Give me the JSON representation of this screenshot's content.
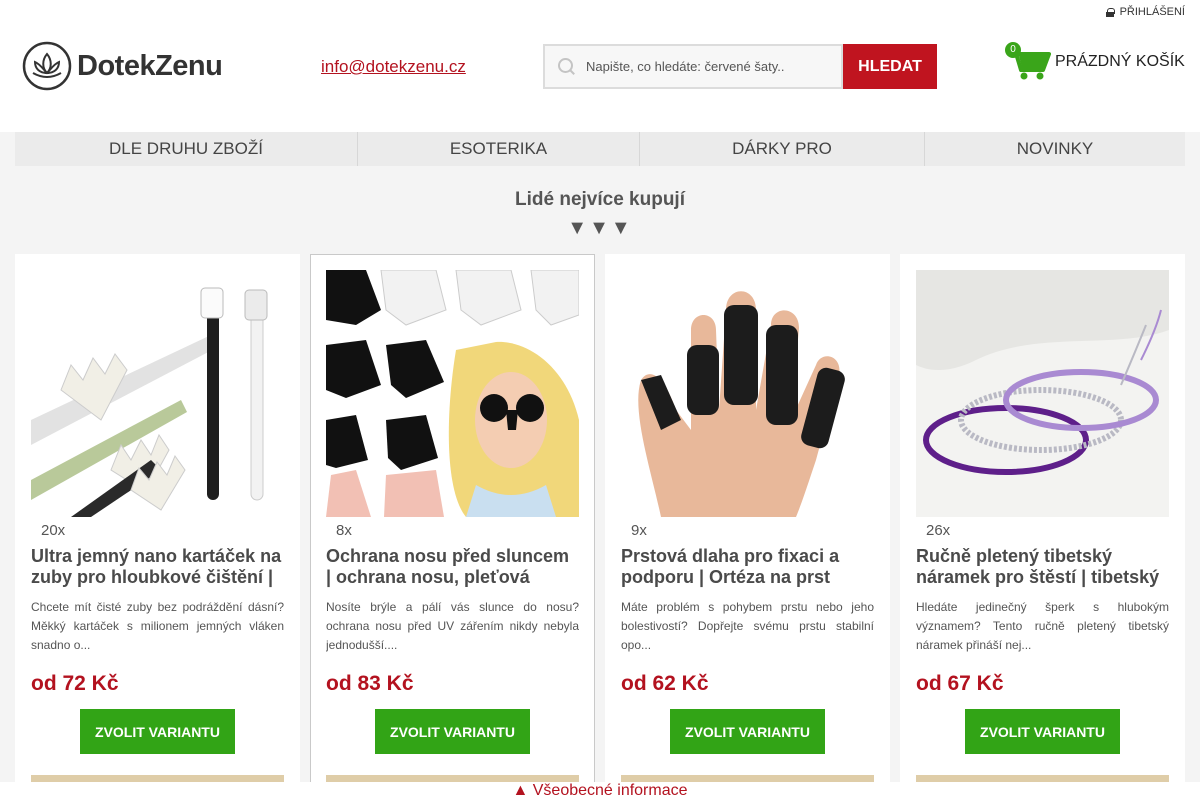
{
  "header": {
    "login_label": "PŘIHLÁŠENÍ",
    "logo_text": "DotekZenu",
    "email": "info@dotekzenu.cz",
    "search_placeholder": "Napište, co hledáte: červené šaty..",
    "search_button": "HLEDAT",
    "cart_count": "0",
    "cart_label": "PRÁZDNÝ KOŠÍK"
  },
  "nav": {
    "items": [
      {
        "label": "DLE DRUHU ZBOŽÍ"
      },
      {
        "label": "ESOTERIKA"
      },
      {
        "label": "DÁRKY PRO"
      },
      {
        "label": "NOVINKY"
      }
    ]
  },
  "section": {
    "title": "Lidé nejvíce kupují",
    "arrows": "▼▼▼"
  },
  "products": [
    {
      "count": "20x",
      "title": "Ultra jemný nano kartáček na zuby pro hloubkové čištění |",
      "description": "Chcete mít čisté zuby bez podráždění dásní? Měkký kartáček s milionem jemných vláken snadno o...",
      "price": "od 72 Kč",
      "button": "ZVOLIT VARIANTU"
    },
    {
      "count": "8x",
      "title": "Ochrana nosu před sluncem | ochrana nosu, pleťová",
      "description": "Nosíte brýle a pálí vás slunce do nosu? ochrana nosu před UV zářením nikdy nebyla jednodušší....",
      "price": "od 83 Kč",
      "button": "ZVOLIT VARIANTU"
    },
    {
      "count": "9x",
      "title": "Prstová dlaha pro fixaci a podporu | Ortéza na prst",
      "description": "Máte problém s pohybem prstu nebo jeho bolestivostí? Dopřejte svému prstu stabilní opo...",
      "price": "od 62 Kč",
      "button": "ZVOLIT VARIANTU"
    },
    {
      "count": "26x",
      "title": "Ručně pletený tibetský náramek pro štěstí | tibetský",
      "description": "Hledáte jedinečný šperk s hlubokým významem? Tento ručně pletený tibetský náramek přináší nej...",
      "price": "od 67 Kč",
      "button": "ZVOLIT VARIANTU"
    }
  ],
  "footer": {
    "info_label": "▲ Všeobecné informace"
  },
  "colors": {
    "brand_red": "#c0141f",
    "price_red": "#b3121f",
    "cta_green": "#32a416",
    "cart_green": "#3aa51a"
  }
}
